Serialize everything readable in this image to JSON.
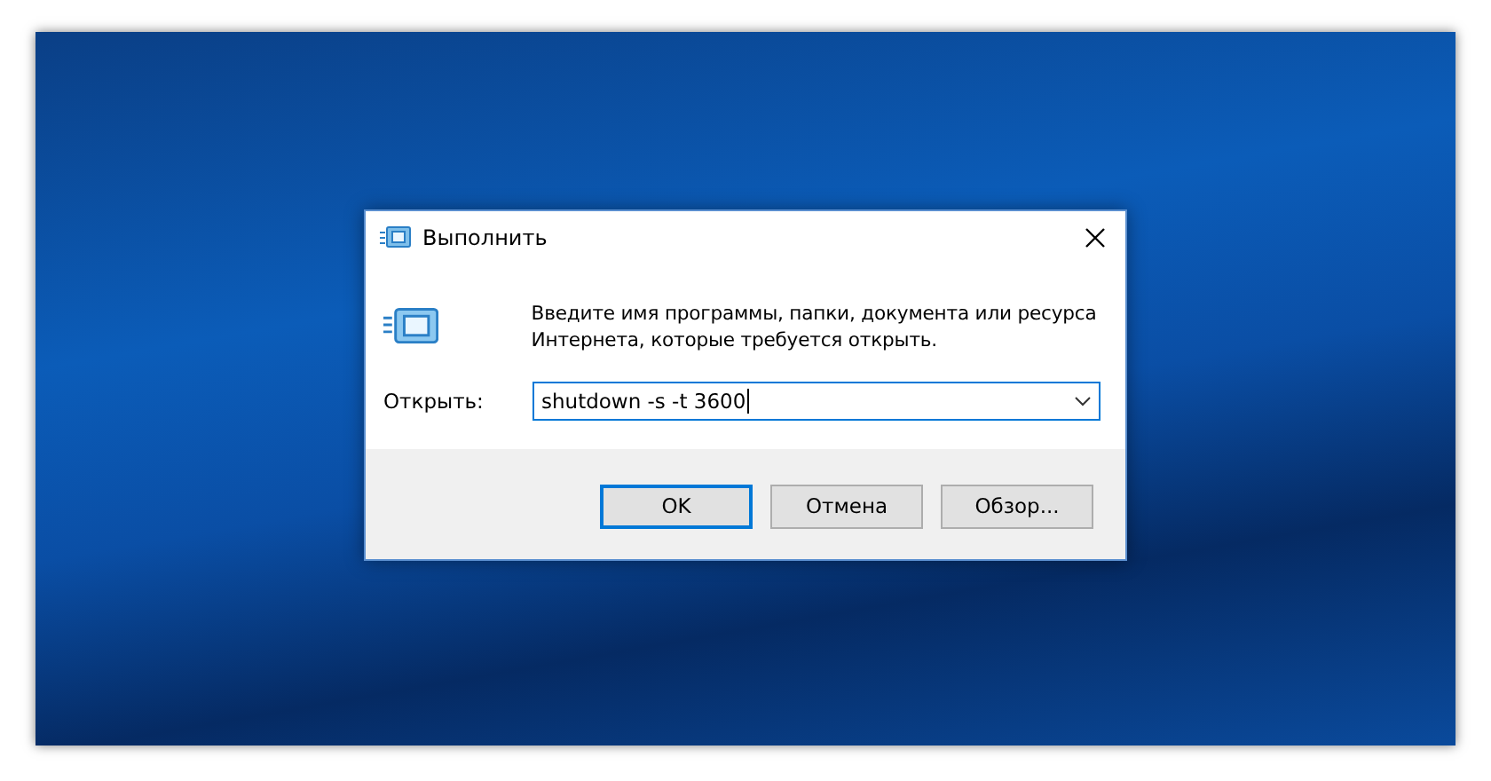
{
  "window": {
    "title": "Выполнить"
  },
  "message": "Введите имя программы, папки, документа или ресурса Интернета, которые требуется открыть.",
  "open_field": {
    "label": "Открыть:",
    "value": "shutdown -s -t 3600"
  },
  "buttons": [
    {
      "label": "OK",
      "default": true
    },
    {
      "label": "Отмена",
      "default": false
    },
    {
      "label": "Обзор...",
      "default": false
    }
  ]
}
